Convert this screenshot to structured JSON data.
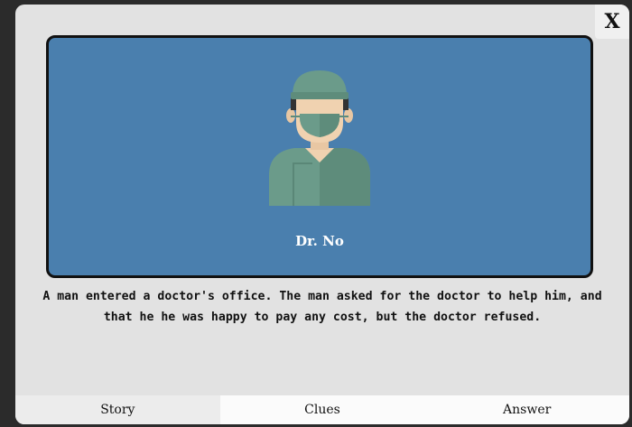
{
  "modal": {
    "close_label": "X"
  },
  "character": {
    "name": "Dr. No",
    "icon": "surgeon-avatar-icon"
  },
  "story": {
    "text": "A man entered a doctor's office. The man asked for the doctor to help him, and that he he was happy to pay any cost, but the doctor refused."
  },
  "tabs": [
    {
      "label": "Story"
    },
    {
      "label": "Clues"
    },
    {
      "label": "Answer"
    }
  ],
  "colors": {
    "card_background": "#4a7fae",
    "scrubs": "#6b9b8a",
    "skin": "#f0d2b0",
    "hair": "#333333"
  }
}
